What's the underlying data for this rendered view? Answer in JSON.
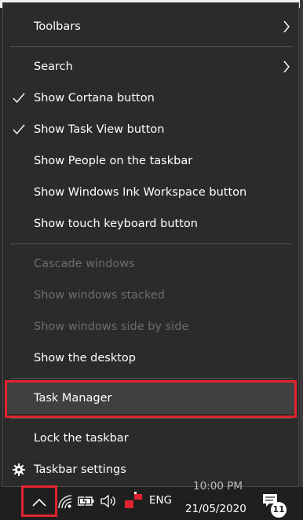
{
  "menu": {
    "items": [
      {
        "label": "Toolbars",
        "state": "submenu"
      },
      {
        "label": "Search",
        "state": "submenu"
      },
      {
        "label": "Show Cortana button",
        "state": "checked"
      },
      {
        "label": "Show Task View button",
        "state": "checked"
      },
      {
        "label": "Show People on the taskbar",
        "state": "normal"
      },
      {
        "label": "Show Windows Ink Workspace button",
        "state": "normal"
      },
      {
        "label": "Show touch keyboard button",
        "state": "normal"
      },
      {
        "label": "Cascade windows",
        "state": "disabled"
      },
      {
        "label": "Show windows stacked",
        "state": "disabled"
      },
      {
        "label": "Show windows side by side",
        "state": "disabled"
      },
      {
        "label": "Show the desktop",
        "state": "normal"
      },
      {
        "label": "Task Manager",
        "state": "highlighted"
      },
      {
        "label": "Lock the taskbar",
        "state": "normal"
      },
      {
        "label": "Taskbar settings",
        "state": "normal",
        "icon": "gear-icon"
      }
    ]
  },
  "taskbar": {
    "language": "ENG",
    "time": "10:00 PM",
    "date": "21/05/2020",
    "notification_count": "11",
    "icons": [
      "chevron-up-icon",
      "wifi-icon",
      "battery-icon",
      "volume-icon",
      "red-flag-icon",
      "notification-icon"
    ]
  },
  "colors": {
    "menu_bg": "#2b2b2b",
    "highlight_bg": "#404040",
    "annotation_red": "#e0242f",
    "disabled_text": "#6d6d6d"
  }
}
